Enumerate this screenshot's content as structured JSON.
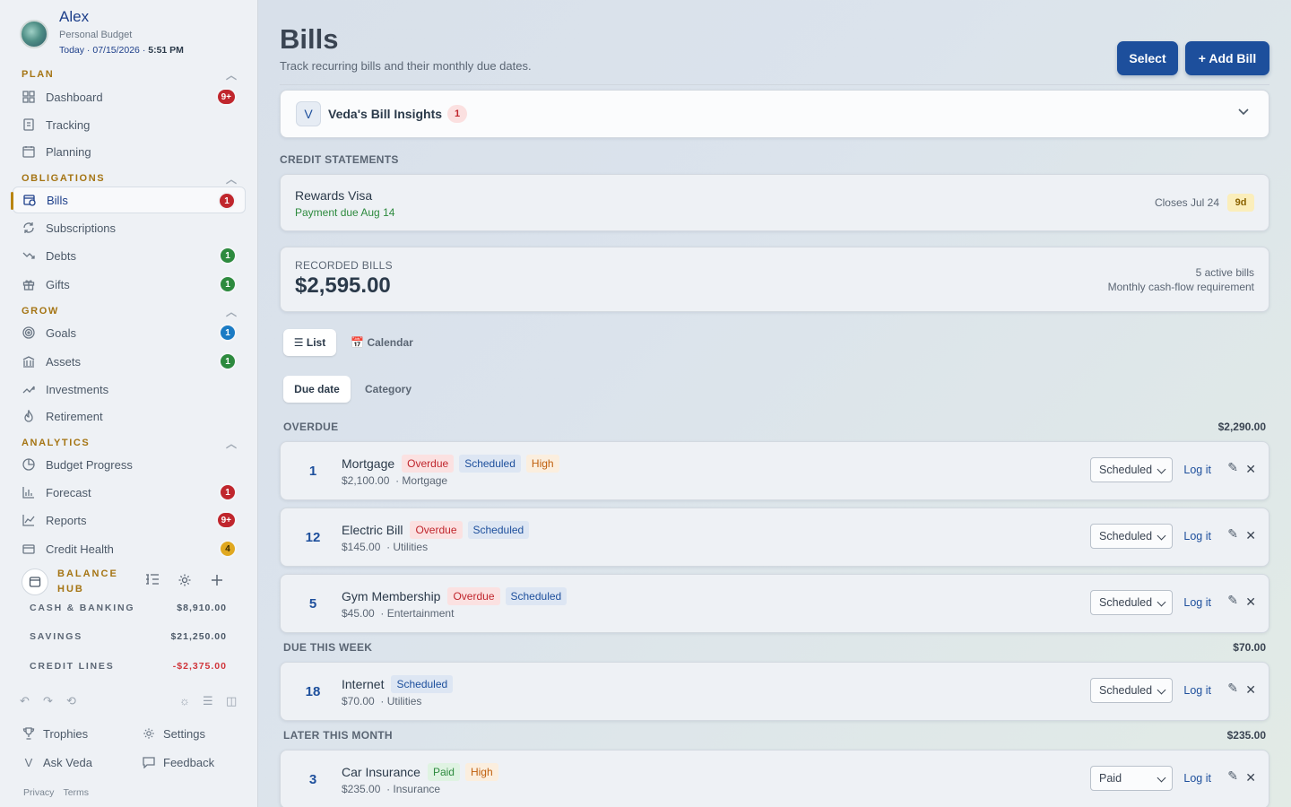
{
  "user": {
    "name": "Alex",
    "budget": "Personal Budget",
    "date_prefix": "Today · 07/15/2026 ·",
    "time": "5:51 PM"
  },
  "sidebar": {
    "sections": {
      "plan": "PLAN",
      "obligations": "OBLIGATIONS",
      "grow": "GROW",
      "analytics": "ANALYTICS"
    },
    "items": {
      "dashboard": {
        "label": "Dashboard",
        "badge": "9+"
      },
      "tracking": {
        "label": "Tracking"
      },
      "planning": {
        "label": "Planning"
      },
      "bills": {
        "label": "Bills",
        "badge": "1"
      },
      "subscriptions": {
        "label": "Subscriptions"
      },
      "debts": {
        "label": "Debts",
        "badge": "1"
      },
      "gifts": {
        "label": "Gifts",
        "badge": "1"
      },
      "goals": {
        "label": "Goals",
        "badge": "1"
      },
      "assets": {
        "label": "Assets",
        "badge": "1"
      },
      "investments": {
        "label": "Investments"
      },
      "retirement": {
        "label": "Retirement"
      },
      "budget_progress": {
        "label": "Budget Progress"
      },
      "forecast": {
        "label": "Forecast",
        "badge": "1"
      },
      "reports": {
        "label": "Reports",
        "badge": "9+"
      },
      "credit_health": {
        "label": "Credit Health",
        "badge": "4"
      }
    },
    "balance_hub": {
      "title_line1": "BALANCE",
      "title_line2": "HUB",
      "rows": [
        {
          "label": "CASH & BANKING",
          "value": "$8,910.00"
        },
        {
          "label": "SAVINGS",
          "value": "$21,250.00"
        },
        {
          "label": "CREDIT LINES",
          "value": "-$2,375.00"
        }
      ]
    },
    "footer": {
      "trophies": "Trophies",
      "settings": "Settings",
      "ask_veda": "Ask Veda",
      "feedback": "Feedback",
      "privacy": "Privacy",
      "terms": "Terms"
    }
  },
  "header": {
    "title": "Bills",
    "subtitle": "Track recurring bills and their monthly due dates.",
    "select_label": "Select",
    "add_label": "+ Add Bill"
  },
  "insights": {
    "icon_letter": "V",
    "title": "Veda's Bill Insights",
    "count": "1"
  },
  "credit": {
    "section": "CREDIT STATEMENTS",
    "card_name": "Rewards Visa",
    "payment_due": "Payment due Aug 14",
    "closes": "Closes Jul 24",
    "days": "9d"
  },
  "recorded": {
    "label": "RECORDED BILLS",
    "amount": "$2,595.00",
    "active": "5 active bills",
    "note": "Monthly cash-flow requirement"
  },
  "views": {
    "list": "☰ List",
    "calendar": "📅 Calendar"
  },
  "groupings": {
    "due_date": "Due date",
    "category": "Category"
  },
  "groups": [
    {
      "label": "OVERDUE",
      "total": "$2,290.00"
    },
    {
      "label": "DUE THIS WEEK",
      "total": "$70.00"
    },
    {
      "label": "LATER THIS MONTH",
      "total": "$235.00"
    }
  ],
  "bills": [
    {
      "day": "1",
      "name": "Mortgage",
      "tags": [
        "Overdue",
        "Scheduled",
        "High"
      ],
      "amount": "$2,100.00",
      "category": "· Mortgage",
      "status": "Scheduled",
      "log": "Log it"
    },
    {
      "day": "12",
      "name": "Electric Bill",
      "tags": [
        "Overdue",
        "Scheduled"
      ],
      "amount": "$145.00",
      "category": "· Utilities",
      "status": "Scheduled",
      "log": "Log it"
    },
    {
      "day": "5",
      "name": "Gym Membership",
      "tags": [
        "Overdue",
        "Scheduled"
      ],
      "amount": "$45.00",
      "category": "· Entertainment",
      "status": "Scheduled",
      "log": "Log it"
    },
    {
      "day": "18",
      "name": "Internet",
      "tags": [
        "Scheduled"
      ],
      "amount": "$70.00",
      "category": "· Utilities",
      "status": "Scheduled",
      "log": "Log it"
    },
    {
      "day": "3",
      "name": "Car Insurance",
      "tags": [
        "Paid",
        "High"
      ],
      "amount": "$235.00",
      "category": "· Insurance",
      "status": "Paid",
      "log": "Log it"
    }
  ]
}
